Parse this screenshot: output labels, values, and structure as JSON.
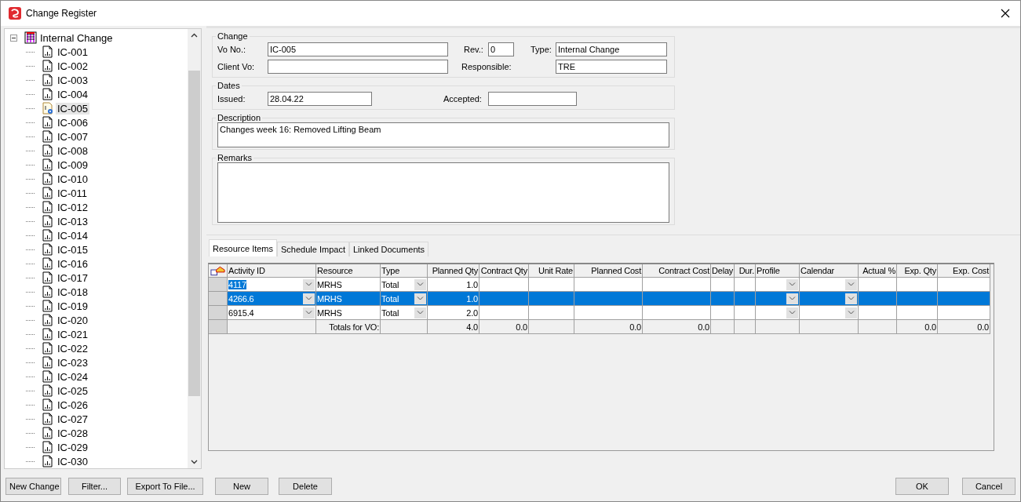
{
  "window": {
    "title": "Change Register"
  },
  "tree": {
    "root": {
      "label": "Internal Change",
      "expanded": true
    },
    "items": [
      {
        "label": "IC-001",
        "selected": false
      },
      {
        "label": "IC-002",
        "selected": false
      },
      {
        "label": "IC-003",
        "selected": false
      },
      {
        "label": "IC-004",
        "selected": false
      },
      {
        "label": "IC-005",
        "selected": true
      },
      {
        "label": "IC-006",
        "selected": false
      },
      {
        "label": "IC-007",
        "selected": false
      },
      {
        "label": "IC-008",
        "selected": false
      },
      {
        "label": "IC-009",
        "selected": false
      },
      {
        "label": "IC-010",
        "selected": false
      },
      {
        "label": "IC-011",
        "selected": false
      },
      {
        "label": "IC-012",
        "selected": false
      },
      {
        "label": "IC-013",
        "selected": false
      },
      {
        "label": "IC-014",
        "selected": false
      },
      {
        "label": "IC-015",
        "selected": false
      },
      {
        "label": "IC-016",
        "selected": false
      },
      {
        "label": "IC-017",
        "selected": false
      },
      {
        "label": "IC-018",
        "selected": false
      },
      {
        "label": "IC-019",
        "selected": false
      },
      {
        "label": "IC-020",
        "selected": false
      },
      {
        "label": "IC-021",
        "selected": false
      },
      {
        "label": "IC-022",
        "selected": false
      },
      {
        "label": "IC-023",
        "selected": false
      },
      {
        "label": "IC-024",
        "selected": false
      },
      {
        "label": "IC-025",
        "selected": false
      },
      {
        "label": "IC-026",
        "selected": false
      },
      {
        "label": "IC-027",
        "selected": false
      },
      {
        "label": "IC-028",
        "selected": false
      },
      {
        "label": "IC-029",
        "selected": false
      },
      {
        "label": "IC-030",
        "selected": false
      }
    ]
  },
  "change": {
    "legend": "Change",
    "vo_no": {
      "label": "Vo No.:",
      "value": "IC-005"
    },
    "rev": {
      "label": "Rev.:",
      "value": "0"
    },
    "type": {
      "label": "Type:",
      "value": "Internal Change"
    },
    "client_vo": {
      "label": "Client Vo:"
    },
    "responsible": {
      "label": "Responsible:",
      "value": "TRE"
    }
  },
  "dates": {
    "legend": "Dates",
    "issued": {
      "label": "Issued:",
      "value": "28.04.22"
    },
    "accepted": {
      "label": "Accepted:"
    }
  },
  "description": {
    "legend": "Description",
    "value": "Changes week 16: Removed Lifting Beam"
  },
  "remarks": {
    "legend": "Remarks"
  },
  "tabs": [
    {
      "label": "Resource Items",
      "selected": true
    },
    {
      "label": "Schedule Impact",
      "selected": false
    },
    {
      "label": "Linked Documents",
      "selected": false
    }
  ],
  "table": {
    "columns": [
      {
        "label": "Activity ID",
        "kind": "text",
        "dropdown": true
      },
      {
        "label": "Resource",
        "kind": "text",
        "dropdown": false
      },
      {
        "label": "Type",
        "kind": "text",
        "dropdown": true
      },
      {
        "label": "Planned Qty",
        "kind": "number",
        "dropdown": false
      },
      {
        "label": "Contract Qty",
        "kind": "number",
        "dropdown": false
      },
      {
        "label": "Unit Rate",
        "kind": "number",
        "dropdown": false
      },
      {
        "label": "Planned Cost",
        "kind": "number",
        "dropdown": false
      },
      {
        "label": "Contract Cost",
        "kind": "number",
        "dropdown": false
      },
      {
        "label": "Delay",
        "kind": "text",
        "dropdown": false
      },
      {
        "label": "Dur.",
        "kind": "number",
        "dropdown": false
      },
      {
        "label": "Profile",
        "kind": "text",
        "dropdown": true
      },
      {
        "label": "Calendar",
        "kind": "text",
        "dropdown": true
      },
      {
        "label": "Actual %",
        "kind": "number",
        "dropdown": false
      },
      {
        "label": "Exp. Qty",
        "kind": "number",
        "dropdown": false
      },
      {
        "label": "Exp. Cost",
        "kind": "number",
        "dropdown": false
      }
    ],
    "rows": [
      {
        "kind": "item",
        "selected": false,
        "editing": true,
        "cells": [
          "4117",
          "MRHS",
          "Total",
          "1.0",
          null,
          null,
          null,
          null,
          null,
          null,
          null,
          null,
          null,
          null,
          null
        ]
      },
      {
        "kind": "item",
        "selected": true,
        "cells": [
          "4266.6",
          "MRHS",
          "Total",
          "1.0",
          null,
          null,
          null,
          null,
          null,
          null,
          null,
          null,
          null,
          null,
          null
        ]
      },
      {
        "kind": "item",
        "selected": false,
        "cells": [
          "6915.4",
          "MRHS",
          "Total",
          "2.0",
          null,
          null,
          null,
          null,
          null,
          null,
          null,
          null,
          null,
          null,
          null
        ]
      },
      {
        "kind": "total",
        "selected": false,
        "cells": [
          null,
          "Totals for VO:",
          null,
          "4.0",
          "0.0",
          null,
          "0.0",
          "0.0",
          null,
          null,
          null,
          null,
          null,
          "0.0",
          "0.0"
        ]
      }
    ]
  },
  "left_buttons": [
    "New Change",
    "Filter...",
    "Export To File..."
  ],
  "grid_buttons": [
    "New",
    "Delete"
  ],
  "dialog_buttons": [
    "OK",
    "Cancel"
  ]
}
